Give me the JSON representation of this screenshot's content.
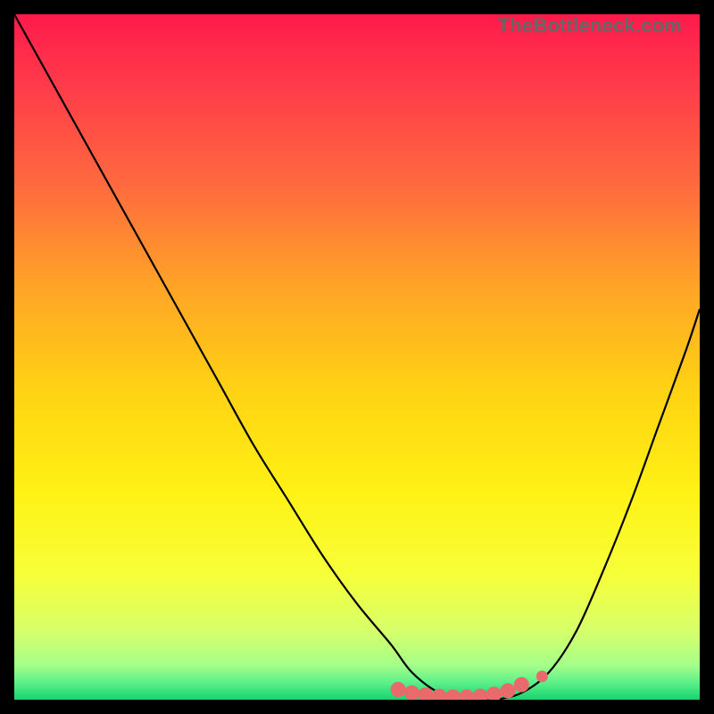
{
  "watermark": "TheBottleneck.com",
  "chart_data": {
    "type": "line",
    "title": "",
    "xlabel": "",
    "ylabel": "",
    "xlim": [
      0,
      100
    ],
    "ylim": [
      0,
      100
    ],
    "background_gradient": {
      "stops": [
        {
          "offset": 0.0,
          "color": "#ff1a4b"
        },
        {
          "offset": 0.1,
          "color": "#ff3a4a"
        },
        {
          "offset": 0.25,
          "color": "#ff6a3e"
        },
        {
          "offset": 0.4,
          "color": "#ffa526"
        },
        {
          "offset": 0.55,
          "color": "#ffd313"
        },
        {
          "offset": 0.7,
          "color": "#fff215"
        },
        {
          "offset": 0.82,
          "color": "#f6ff3a"
        },
        {
          "offset": 0.9,
          "color": "#d6ff6a"
        },
        {
          "offset": 0.95,
          "color": "#a4ff8a"
        },
        {
          "offset": 0.975,
          "color": "#5cf08a"
        },
        {
          "offset": 1.0,
          "color": "#17d36e"
        }
      ]
    },
    "series": [
      {
        "name": "bottleneck-curve",
        "color": "#000000",
        "x": [
          0,
          5,
          10,
          15,
          20,
          25,
          30,
          35,
          40,
          45,
          50,
          55,
          58,
          62,
          66,
          70,
          74,
          78,
          82,
          86,
          90,
          94,
          98,
          100
        ],
        "y": [
          100,
          91,
          82,
          73,
          64,
          55,
          46,
          37,
          29,
          21,
          14,
          8,
          4,
          1,
          0,
          0,
          1,
          4,
          10,
          19,
          29,
          40,
          51,
          57
        ]
      }
    ],
    "markers": [
      {
        "name": "flat-minimum",
        "color": "#e96a6a",
        "x": [
          56,
          58,
          60,
          62,
          64,
          66,
          68,
          70,
          72,
          74
        ],
        "y": [
          1.5,
          1,
          0.7,
          0.5,
          0.4,
          0.4,
          0.5,
          0.8,
          1.3,
          2.2
        ]
      },
      {
        "name": "flat-minimum-end",
        "color": "#e96a6a",
        "x": [
          77
        ],
        "y": [
          3.4
        ]
      }
    ]
  }
}
